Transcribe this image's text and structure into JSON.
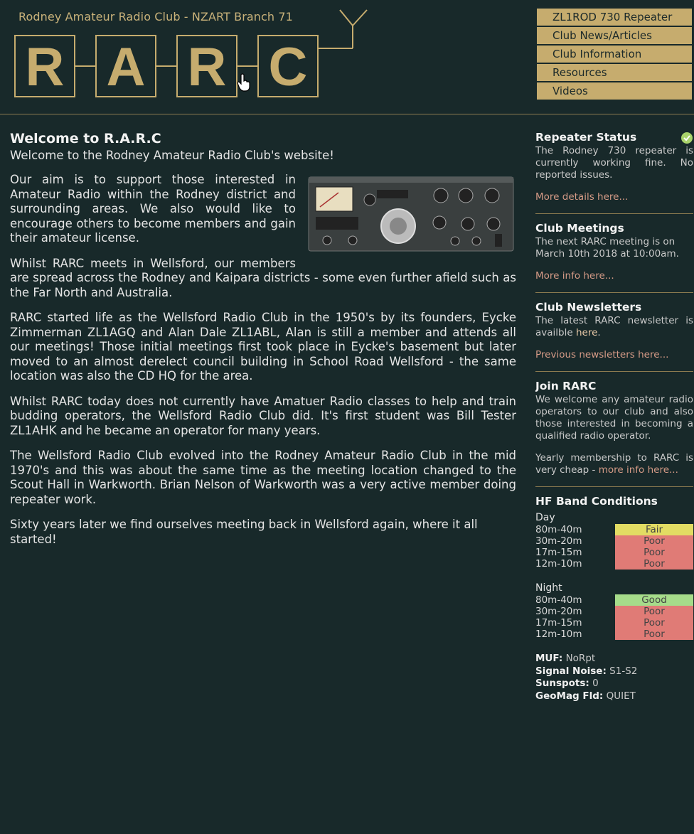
{
  "header": {
    "tagline": "Rodney Amateur Radio Club - NZART Branch 71",
    "logo_letters": [
      "R",
      "A",
      "R",
      "C"
    ]
  },
  "nav": {
    "items": [
      {
        "label": "ZL1ROD 730 Repeater"
      },
      {
        "label": "Club News/Articles"
      },
      {
        "label": "Club Information"
      },
      {
        "label": "Resources"
      },
      {
        "label": "Videos"
      }
    ]
  },
  "main": {
    "title": "Welcome to R.A.R.C",
    "intro": "Welcome to the Rodney Amateur Radio Club's website!",
    "p1": "Our aim is to support those interested in Amateur Radio within the Rodney district and surrounding areas. We also would like to encourage others to become members and gain their amateur license.",
    "p2": "Whilst RARC meets in Wellsford, our members are spread across the Rodney and Kaipara districts - some even further afield such as the Far North and Australia.",
    "p3": "RARC started life as the Wellsford Radio Club in the 1950's by its founders, Eycke Zimmerman ZL1AGQ and Alan Dale ZL1ABL, Alan is still a member and attends all our meetings! Those initial meetings first took place in Eycke's basement but later moved to an almost derelect council building in School Road Wellsford - the same location was also the CD HQ for the area.",
    "p4": "Whilst RARC today does not currently have Amatuer Radio classes to help and train budding operators, the Wellsford Radio Club did. It's first student was Bill Tester ZL1AHK and he became an operator for many years.",
    "p5": "The Wellsford Radio Club evolved into the Rodney Amateur Radio Club in the mid 1970's and this was about the same time as the meeting location changed to the Scout Hall in Warkworth. Brian Nelson of Warkworth was a very active member doing repeater work.",
    "p6": "Sixty years later we find ourselves meeting back in Wellsford again, where it all started!"
  },
  "sidebar": {
    "repeater": {
      "title": "Repeater Status",
      "text": "The Rodney 730 repeater is currently working fine. No reported issues.",
      "link": "More details here..."
    },
    "meetings": {
      "title": "Club Meetings",
      "text": "The next RARC meeting is on March 10th 2018 at 10:00am.",
      "link": "More info here..."
    },
    "newsletters": {
      "title": "Club Newsletters",
      "text_a": "The latest RARC newsletter is availble",
      "text_link": "here",
      "text_b": ".",
      "link": "Previous newsletters here..."
    },
    "join": {
      "title": "Join RARC",
      "text": "We welcome any amateur radio operators to our club and also those interested in becoming a qualified radio operator.",
      "text2_a": "Yearly membership to RARC is very cheap -",
      "text2_link": "more info here..."
    },
    "hf": {
      "title": "HF Band Conditions",
      "day_label": "Day",
      "night_label": "Night",
      "day": [
        {
          "band": "80m-40m",
          "status": "Fair",
          "color": "#e2dc63"
        },
        {
          "band": "30m-20m",
          "status": "Poor",
          "color": "#e07b76"
        },
        {
          "band": "17m-15m",
          "status": "Poor",
          "color": "#e07b76"
        },
        {
          "band": "12m-10m",
          "status": "Poor",
          "color": "#e07b76"
        }
      ],
      "night": [
        {
          "band": "80m-40m",
          "status": "Good",
          "color": "#a6dc8a"
        },
        {
          "band": "30m-20m",
          "status": "Poor",
          "color": "#e07b76"
        },
        {
          "band": "17m-15m",
          "status": "Poor",
          "color": "#e07b76"
        },
        {
          "band": "12m-10m",
          "status": "Poor",
          "color": "#e07b76"
        }
      ],
      "stats": [
        {
          "label": "MUF:",
          "value": "NoRpt"
        },
        {
          "label": "Signal Noise:",
          "value": "S1-S2"
        },
        {
          "label": "Sunspots:",
          "value": "0"
        },
        {
          "label": "GeoMag Fld:",
          "value": "QUIET"
        }
      ]
    }
  },
  "colors": {
    "background": "#18292a",
    "gold": "#c6ac6e",
    "link": "#d49a86",
    "status_ok": "#a9d36b"
  }
}
